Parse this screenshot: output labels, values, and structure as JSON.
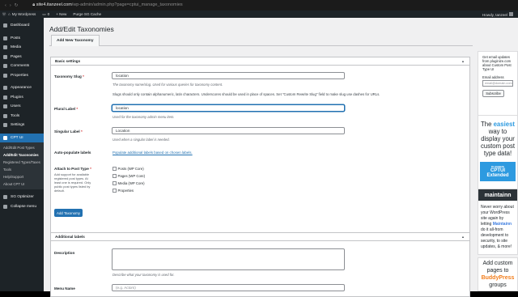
{
  "browser": {
    "url_host": "site4.itanzeel.com",
    "url_path": "/wp-admin/admin.php?page=cptui_manage_taxonomies"
  },
  "adminbar": {
    "site": "My Wordpress",
    "comments": "0",
    "new": "+ New",
    "cache": "Purge SG Cache",
    "howdy": "Howdy, tanzeel"
  },
  "sidebar": {
    "dashboard": "Dashboard",
    "posts": "Posts",
    "media": "Media",
    "pages": "Pages",
    "comments": "Comments",
    "properties": "Properties",
    "appearance": "Appearance",
    "plugins": "Plugins",
    "users": "Users",
    "tools": "Tools",
    "settings": "Settings",
    "cptui": "CPT UI",
    "sub": {
      "post_types": "Add/Edit Post Types",
      "taxonomies": "Add/Edit Taxonomies",
      "registered": "Registered Types/Taxes",
      "tools": "Tools",
      "help": "Help/Support",
      "about": "About CPT UI"
    },
    "sg": "SG Optimizer",
    "collapse": "Collapse menu"
  },
  "page": {
    "title": "Add/Edit Taxonomies",
    "tab": "Add New Taxonomy"
  },
  "basic": {
    "heading": "Basic settings",
    "slug_label": "Taxonomy Slug",
    "slug_value": "location",
    "slug_desc": "The taxonomy name/slug. Used for various queries for taxonomy content.",
    "slug_note": "Slugs should only contain alphanumeric, latin characters. Underscores should be used in place of spaces. Set \"Custom Rewrite Slug\" field to make slug use dashes for URLs.",
    "plural_label": "Plural Label",
    "plural_value": "location",
    "plural_desc": "Used for the taxonomy admin menu item.",
    "singular_label": "Singular Label",
    "singular_value": "Location",
    "singular_desc": "Used when a singular label is needed.",
    "auto_label": "Auto-populate labels",
    "auto_link": "Populate additional labels based on chosen labels.",
    "attach_label": "Attach to Post Type",
    "attach_help": "Add support for available registered post types. At least one is required. Only public post types listed by default.",
    "options": [
      "Posts (WP Core)",
      "Pages (WP Core)",
      "Media (WP Core)",
      "Properties"
    ],
    "add_button": "Add Taxonomy"
  },
  "additional": {
    "heading": "Additional labels",
    "desc_label": "Description",
    "desc_help": "Describe what your taxonomy is used for.",
    "menu_label": "Menu Name",
    "menu_placeholder": "(e.g. Actors)"
  },
  "right": {
    "signup": "Get email updates from pluginize.com about Custom Post Type UI",
    "email_label": "Email address",
    "email_placeholder": "email@domain.com",
    "subscribe": "Subscribe",
    "ad1_pre": "The",
    "ad1_hl": "easiest",
    "ad1_post": "way to display your custom post type data!",
    "pluginize": "PLUGINIZE",
    "cptui_ext": "CPTUI Extended",
    "maintainn": "maintainn",
    "ad2_pre": "Never worry about your WordPress site again by letting",
    "ad2_hl": "Maintainn",
    "ad2_post": "do it all-from development to security, to site updates, & more!",
    "ad3_pre": "Add custom pages to",
    "ad3_hl": "BuddyPress",
    "ad3_post": "groups"
  },
  "colors": {
    "accent": "#2271b1",
    "sidebar": "#1d2327",
    "easiest": "#2d9ae0"
  }
}
